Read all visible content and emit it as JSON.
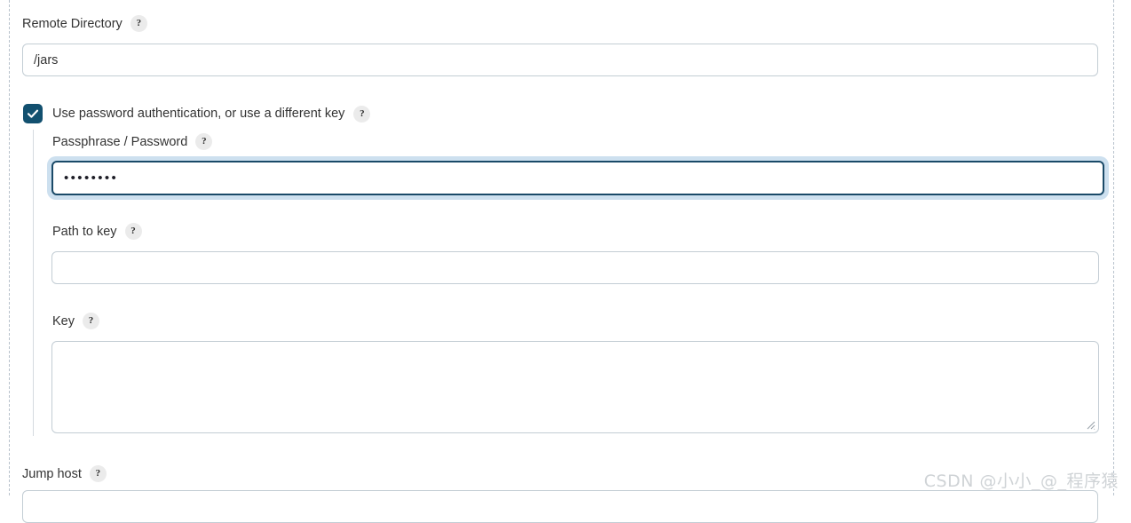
{
  "form": {
    "remote_directory": {
      "label": "Remote Directory",
      "help": "?",
      "value": "/jars",
      "placeholder": ""
    },
    "use_password_auth": {
      "label": "Use password authentication, or use a different key",
      "help": "?",
      "checked": true,
      "check_glyph": "check-icon"
    },
    "passphrase": {
      "label": "Passphrase / Password",
      "help": "?",
      "value": "••••••••",
      "placeholder": "",
      "focused": true
    },
    "path_to_key": {
      "label": "Path to key",
      "help": "?",
      "value": "",
      "placeholder": ""
    },
    "key": {
      "label": "Key",
      "help": "?",
      "value": "",
      "placeholder": ""
    },
    "jump_host": {
      "label": "Jump host",
      "help": "?",
      "value": "",
      "placeholder": ""
    }
  },
  "watermark": {
    "text": "CSDN @小小_@_程序猿"
  },
  "colors": {
    "checkbox_fill": "#12506f",
    "focus_ring": "#cde0ef",
    "focus_border": "#1a4a68",
    "input_border": "#c3cdd4",
    "label_text": "#333333",
    "help_badge_bg": "#ebebeb",
    "panel_dashed_border": "#b8c2cc",
    "indent_guide": "#d5dbdf",
    "watermark_text": "#cfd3d6"
  }
}
